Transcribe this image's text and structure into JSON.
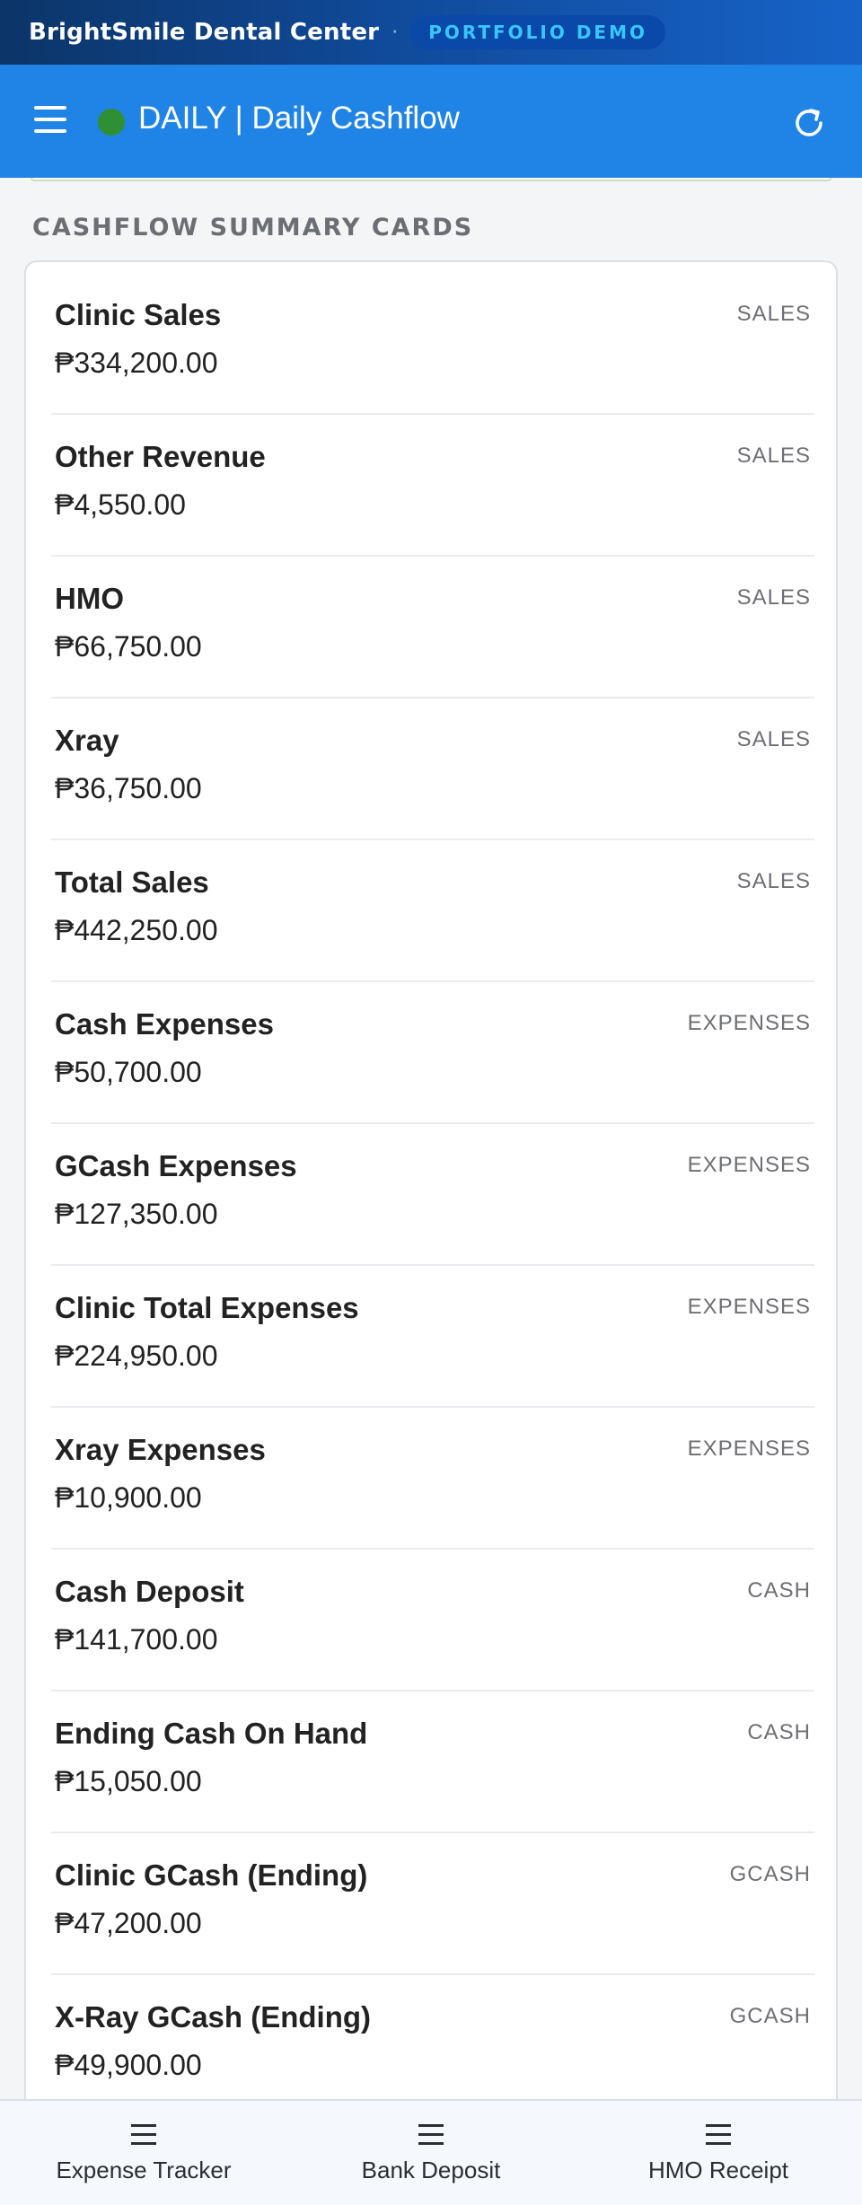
{
  "brand": {
    "name": "BrightSmile Dental Center",
    "separator": "·",
    "badge": "PORTFOLIO DEMO"
  },
  "header": {
    "title": "DAILY | Daily Cashflow",
    "status_color": "#2f8f34",
    "menu_icon": "hamburger-menu-icon",
    "refresh_icon": "refresh-icon"
  },
  "section": {
    "title": "CASHFLOW SUMMARY CARDS"
  },
  "cards": [
    {
      "label": "Clinic Sales",
      "value": "₱334,200.00",
      "tag": "SALES"
    },
    {
      "label": "Other Revenue",
      "value": "₱4,550.00",
      "tag": "SALES"
    },
    {
      "label": "HMO",
      "value": "₱66,750.00",
      "tag": "SALES"
    },
    {
      "label": "Xray",
      "value": "₱36,750.00",
      "tag": "SALES"
    },
    {
      "label": "Total Sales",
      "value": "₱442,250.00",
      "tag": "SALES"
    },
    {
      "label": "Cash Expenses",
      "value": "₱50,700.00",
      "tag": "EXPENSES"
    },
    {
      "label": "GCash Expenses",
      "value": "₱127,350.00",
      "tag": "EXPENSES"
    },
    {
      "label": "Clinic Total Expenses",
      "value": "₱224,950.00",
      "tag": "EXPENSES"
    },
    {
      "label": "Xray Expenses",
      "value": "₱10,900.00",
      "tag": "EXPENSES"
    },
    {
      "label": "Cash Deposit",
      "value": "₱141,700.00",
      "tag": "CASH"
    },
    {
      "label": "Ending Cash On Hand",
      "value": "₱15,050.00",
      "tag": "CASH"
    },
    {
      "label": "Clinic GCash (Ending)",
      "value": "₱47,200.00",
      "tag": "GCASH"
    },
    {
      "label": "X-Ray GCash (Ending)",
      "value": "₱49,900.00",
      "tag": "GCASH"
    }
  ],
  "bottom_nav": [
    {
      "label": "Expense Tracker",
      "icon": "list-icon"
    },
    {
      "label": "Bank Deposit",
      "icon": "list-icon"
    },
    {
      "label": "HMO Receipt",
      "icon": "list-icon"
    }
  ]
}
